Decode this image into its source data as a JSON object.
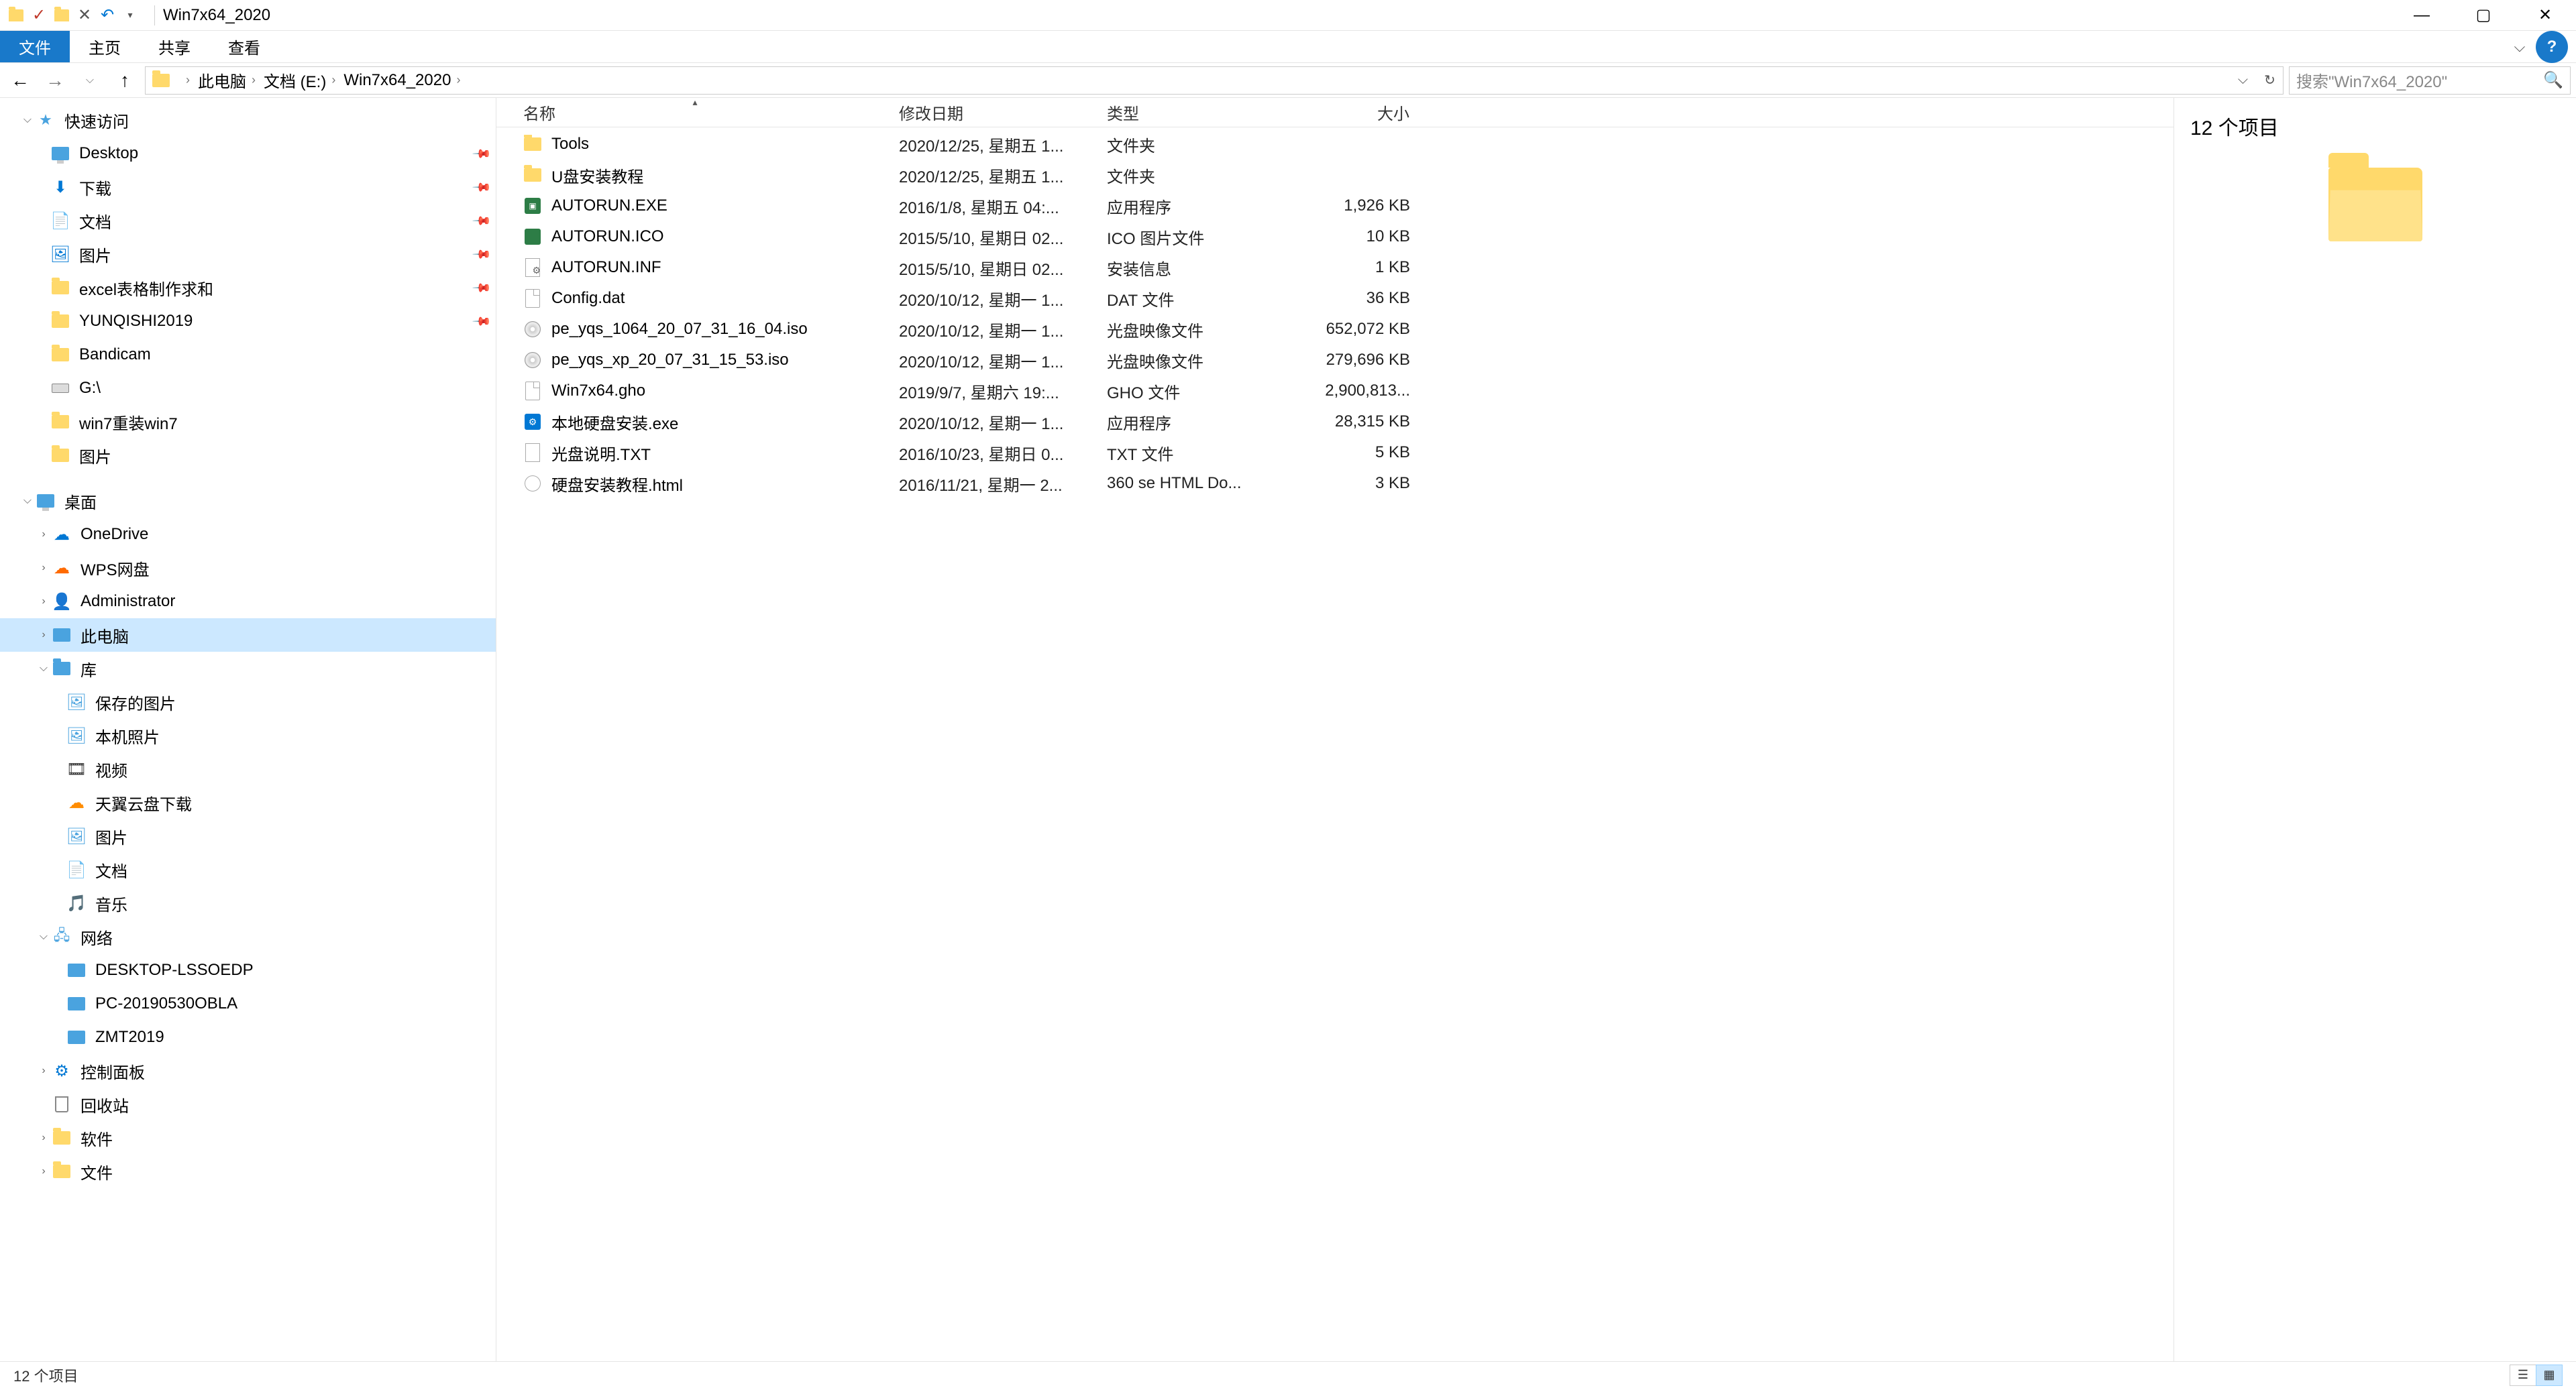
{
  "window": {
    "title": "Win7x64_2020"
  },
  "ribbon": {
    "file": "文件",
    "home": "主页",
    "share": "共享",
    "view": "查看"
  },
  "breadcrumb": {
    "items": [
      "此电脑",
      "文档 (E:)",
      "Win7x64_2020"
    ]
  },
  "search": {
    "placeholder": "搜索\"Win7x64_2020\""
  },
  "tree": {
    "quick_access": "快速访问",
    "desktop": "Desktop",
    "downloads": "下载",
    "documents": "文档",
    "pictures": "图片",
    "excel": "excel表格制作求和",
    "yunqishi": "YUNQISHI2019",
    "bandicam": "Bandicam",
    "g_drive": "G:\\",
    "win7reinstall": "win7重装win7",
    "pictures2": "图片",
    "desktop_zh": "桌面",
    "onedrive": "OneDrive",
    "wps": "WPS网盘",
    "administrator": "Administrator",
    "this_pc": "此电脑",
    "libraries": "库",
    "saved_pictures": "保存的图片",
    "camera_roll": "本机照片",
    "videos": "视频",
    "tianyi": "天翼云盘下载",
    "lib_pictures": "图片",
    "lib_documents": "文档",
    "lib_music": "音乐",
    "network": "网络",
    "desktop_lssoedp": "DESKTOP-LSSOEDP",
    "pc_2019": "PC-20190530OBLA",
    "zmt": "ZMT2019",
    "control_panel": "控制面板",
    "recycle_bin": "回收站",
    "software": "软件",
    "files": "文件"
  },
  "columns": {
    "name": "名称",
    "date": "修改日期",
    "type": "类型",
    "size": "大小"
  },
  "files": [
    {
      "icon": "folder",
      "name": "Tools",
      "date": "2020/12/25, 星期五 1...",
      "type": "文件夹",
      "size": ""
    },
    {
      "icon": "folder",
      "name": "U盘安装教程",
      "date": "2020/12/25, 星期五 1...",
      "type": "文件夹",
      "size": ""
    },
    {
      "icon": "exe",
      "name": "AUTORUN.EXE",
      "date": "2016/1/8, 星期五 04:...",
      "type": "应用程序",
      "size": "1,926 KB"
    },
    {
      "icon": "ico",
      "name": "AUTORUN.ICO",
      "date": "2015/5/10, 星期日 02...",
      "type": "ICO 图片文件",
      "size": "10 KB"
    },
    {
      "icon": "inf",
      "name": "AUTORUN.INF",
      "date": "2015/5/10, 星期日 02...",
      "type": "安装信息",
      "size": "1 KB"
    },
    {
      "icon": "file",
      "name": "Config.dat",
      "date": "2020/10/12, 星期一 1...",
      "type": "DAT 文件",
      "size": "36 KB"
    },
    {
      "icon": "disc",
      "name": "pe_yqs_1064_20_07_31_16_04.iso",
      "date": "2020/10/12, 星期一 1...",
      "type": "光盘映像文件",
      "size": "652,072 KB"
    },
    {
      "icon": "disc",
      "name": "pe_yqs_xp_20_07_31_15_53.iso",
      "date": "2020/10/12, 星期一 1...",
      "type": "光盘映像文件",
      "size": "279,696 KB"
    },
    {
      "icon": "file",
      "name": "Win7x64.gho",
      "date": "2019/9/7, 星期六 19:...",
      "type": "GHO 文件",
      "size": "2,900,813..."
    },
    {
      "icon": "app",
      "name": "本地硬盘安装.exe",
      "date": "2020/10/12, 星期一 1...",
      "type": "应用程序",
      "size": "28,315 KB"
    },
    {
      "icon": "txt",
      "name": "光盘说明.TXT",
      "date": "2016/10/23, 星期日 0...",
      "type": "TXT 文件",
      "size": "5 KB"
    },
    {
      "icon": "html",
      "name": "硬盘安装教程.html",
      "date": "2016/11/21, 星期一 2...",
      "type": "360 se HTML Do...",
      "size": "3 KB"
    }
  ],
  "preview": {
    "title": "12 个项目"
  },
  "statusbar": {
    "text": "12 个项目"
  }
}
